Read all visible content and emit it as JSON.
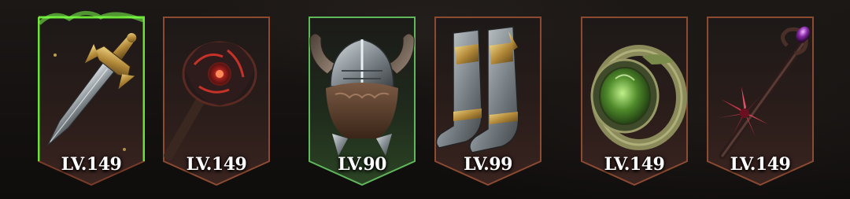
{
  "equipment": {
    "items": [
      {
        "slot": "weapon",
        "icon": "sword-icon",
        "level": "LV.149",
        "frame": "legendary-green"
      },
      {
        "slot": "offhand",
        "icon": "axe-icon",
        "level": "LV.149",
        "frame": "bronze"
      },
      {
        "slot": "helmet",
        "icon": "helmet-icon",
        "level": "LV.90",
        "frame": "green"
      },
      {
        "slot": "boots",
        "icon": "boots-icon",
        "level": "LV.99",
        "frame": "bronze"
      },
      {
        "slot": "ring",
        "icon": "ring-icon",
        "level": "LV.149",
        "frame": "bronze"
      },
      {
        "slot": "staff",
        "icon": "staff-icon",
        "level": "LV.149",
        "frame": "bronze"
      }
    ]
  },
  "colors": {
    "bronze_frame": "#8c4a30",
    "green_frame": "#5fb85a",
    "legendary_glow": "#6cff3a",
    "level_text": "#ffffff"
  }
}
